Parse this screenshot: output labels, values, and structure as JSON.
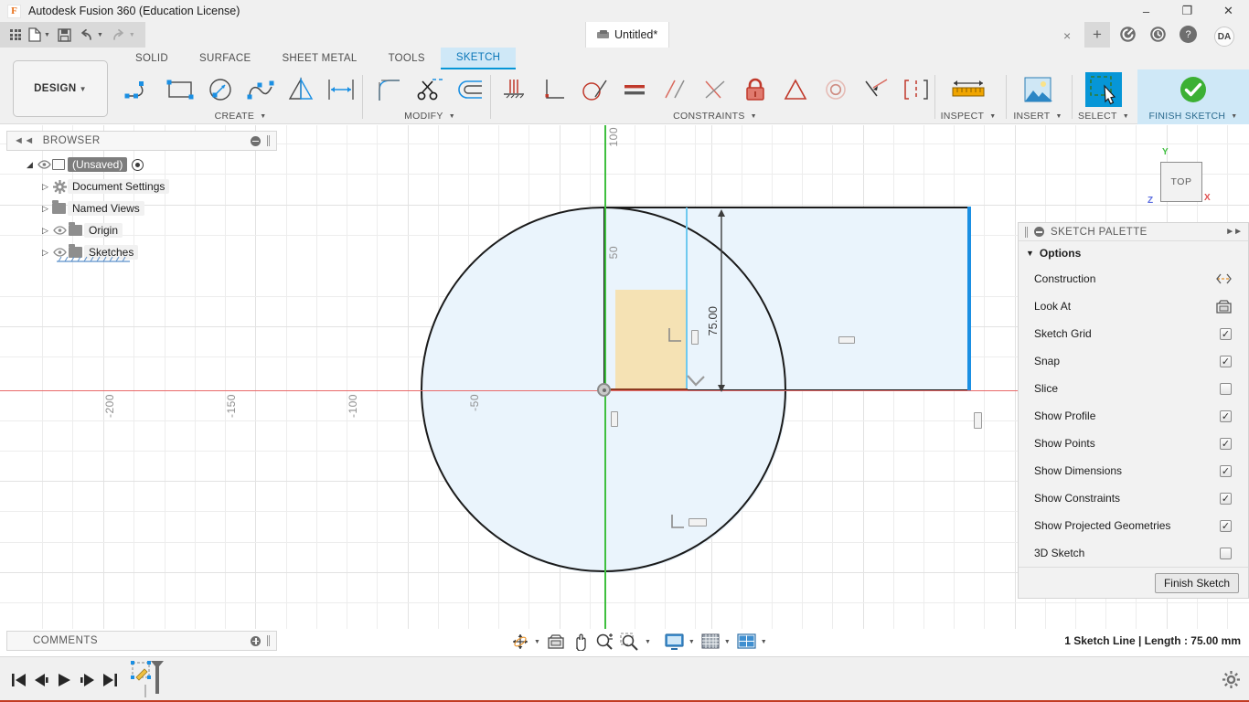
{
  "window": {
    "title": "Autodesk Fusion 360 (Education License)",
    "logo_icon": "fusion-logo-icon",
    "minimize_icon": "minimize-icon",
    "maximize_icon": "maximize-icon",
    "close_icon": "close-icon"
  },
  "quick_access": {
    "app_grid_icon": "app-grid-icon",
    "new_icon": "new-document-icon",
    "save_icon": "save-icon",
    "undo_icon": "undo-icon",
    "redo_icon": "redo-icon"
  },
  "document_tab": {
    "name": "Untitled*",
    "doc_icon": "document-icon",
    "close_label": "×",
    "new_tab_label": "+"
  },
  "top_right": {
    "job_status_icon": "job-status-icon",
    "recent_icon": "recent-clock-icon",
    "help_icon": "help-icon",
    "avatar_initials": "DA"
  },
  "workspace": {
    "label": "DESIGN"
  },
  "ribbon_tabs": [
    {
      "label": "SOLID",
      "active": false
    },
    {
      "label": "SURFACE",
      "active": false
    },
    {
      "label": "SHEET METAL",
      "active": false
    },
    {
      "label": "TOOLS",
      "active": false
    },
    {
      "label": "SKETCH",
      "active": true
    }
  ],
  "ribbon_groups": [
    {
      "name": "CREATE",
      "label": "CREATE",
      "has_dropdown": true,
      "tools": [
        {
          "name": "line-tool",
          "icon": "line-icon"
        },
        {
          "name": "rectangle-tool",
          "icon": "rectangle-icon"
        },
        {
          "name": "circle-tool",
          "icon": "circle-icon"
        },
        {
          "name": "spline-tool",
          "icon": "spline-icon"
        },
        {
          "name": "mirror-tool",
          "icon": "mirror-icon"
        },
        {
          "name": "sketch-dimension-tool",
          "icon": "dimension-icon"
        }
      ]
    },
    {
      "name": "MODIFY",
      "label": "MODIFY",
      "has_dropdown": true,
      "tools": [
        {
          "name": "fillet-tool",
          "icon": "fillet-icon"
        },
        {
          "name": "trim-tool",
          "icon": "scissors-icon"
        },
        {
          "name": "offset-tool",
          "icon": "offset-icon"
        }
      ]
    },
    {
      "name": "CONSTRAINTS",
      "label": "CONSTRAINTS",
      "has_dropdown": true,
      "tools": [
        {
          "name": "horizontal-vertical-constraint",
          "icon": "horizontal-vertical-icon"
        },
        {
          "name": "perpendicular-constraint",
          "icon": "perpendicular-icon"
        },
        {
          "name": "tangent-constraint",
          "icon": "tangent-icon"
        },
        {
          "name": "equal-constraint",
          "icon": "equal-icon"
        },
        {
          "name": "parallel-constraint",
          "icon": "parallel-icon"
        },
        {
          "name": "coincident-constraint",
          "icon": "coincident-icon"
        },
        {
          "name": "fix-unfix-constraint",
          "icon": "lock-icon"
        },
        {
          "name": "symmetry-constraint",
          "icon": "symmetry-triangle-icon"
        },
        {
          "name": "concentric-constraint",
          "icon": "concentric-icon"
        },
        {
          "name": "midpoint-constraint",
          "icon": "midpoint-icon"
        },
        {
          "name": "curvature-constraint",
          "icon": "curvature-icon"
        }
      ]
    },
    {
      "name": "INSPECT",
      "label": "INSPECT",
      "has_dropdown": true,
      "tools": [
        {
          "name": "measure-tool",
          "icon": "ruler-icon"
        }
      ]
    },
    {
      "name": "INSERT",
      "label": "INSERT",
      "has_dropdown": true,
      "tools": [
        {
          "name": "insert-image-tool",
          "icon": "image-icon"
        }
      ]
    },
    {
      "name": "SELECT",
      "label": "SELECT",
      "has_dropdown": true,
      "active": true,
      "tools": [
        {
          "name": "select-tool",
          "icon": "select-cursor-icon"
        }
      ]
    },
    {
      "name": "FINISH SKETCH",
      "label": "FINISH SKETCH",
      "has_dropdown": true,
      "highlighted": true,
      "tools": [
        {
          "name": "finish-sketch-tool",
          "icon": "green-check-icon"
        }
      ]
    }
  ],
  "browser": {
    "title": "BROWSER",
    "collapse_icon": "collapse-left-icon",
    "minus_icon": "minus-circle-icon",
    "grip_icon": "grip-icon",
    "items": [
      {
        "label": "(Unsaved)",
        "icon": "body-icon",
        "has_eye": true,
        "has_radio": true,
        "root": true,
        "arrow": "◢"
      },
      {
        "label": "Document Settings",
        "icon": "gear-icon",
        "has_eye": false,
        "arrow": "▷"
      },
      {
        "label": "Named Views",
        "icon": "folder-icon",
        "has_eye": false,
        "arrow": "▷"
      },
      {
        "label": "Origin",
        "icon": "folder-icon",
        "has_eye": true,
        "arrow": "▷"
      },
      {
        "label": "Sketches",
        "icon": "folder-sketch-icon",
        "has_eye": true,
        "arrow": "▷"
      }
    ]
  },
  "sketch_palette": {
    "title": "SKETCH PALETTE",
    "minus_icon": "minus-circle-icon",
    "expand_icon": "expand-right-icon",
    "section_label": "Options",
    "section_arrow": "▼",
    "options": [
      {
        "label": "Construction",
        "type": "icon",
        "icon": "construction-icon"
      },
      {
        "label": "Look At",
        "type": "icon",
        "icon": "look-at-icon"
      },
      {
        "label": "Sketch Grid",
        "type": "checkbox",
        "checked": true
      },
      {
        "label": "Snap",
        "type": "checkbox",
        "checked": true
      },
      {
        "label": "Slice",
        "type": "checkbox",
        "checked": false
      },
      {
        "label": "Show Profile",
        "type": "checkbox",
        "checked": true
      },
      {
        "label": "Show Points",
        "type": "checkbox",
        "checked": true
      },
      {
        "label": "Show Dimensions",
        "type": "checkbox",
        "checked": true
      },
      {
        "label": "Show Constraints",
        "type": "checkbox",
        "checked": true
      },
      {
        "label": "Show Projected Geometries",
        "type": "checkbox",
        "checked": true
      },
      {
        "label": "3D Sketch",
        "type": "checkbox",
        "checked": false
      }
    ],
    "finish_button": "Finish Sketch"
  },
  "canvas": {
    "dimension_label": "75.00",
    "grid_labels_x": [
      "-200",
      "-150",
      "-100",
      "-50"
    ],
    "grid_labels_y": [
      "100",
      "50"
    ],
    "viewcube": {
      "face": "TOP",
      "axis_x": "X",
      "axis_y": "Y",
      "axis_z": "Z"
    },
    "colors": {
      "profile_fill": "#eaf4fc",
      "selected_line": "#1a8fe3",
      "sketch_line": "#1a1a1a",
      "tan_region": "#f5dfae",
      "x_axis": "#e86a6a",
      "y_axis": "#3fbf3f",
      "projected_line": "#6fc9ef",
      "fixed_line": "#8c3a20"
    }
  },
  "comments": {
    "title": "COMMENTS",
    "add_icon": "plus-circle-icon",
    "grip_icon": "grip-icon"
  },
  "navigation_bar": [
    {
      "name": "orbit-tool",
      "icon": "orbit-icon",
      "dropdown": true
    },
    {
      "name": "look-at-tool",
      "icon": "look-at-icon",
      "dropdown": false
    },
    {
      "name": "pan-tool",
      "icon": "pan-hand-icon",
      "dropdown": false
    },
    {
      "name": "zoom-tool",
      "icon": "zoom-icon",
      "dropdown": false
    },
    {
      "name": "fit-tool",
      "icon": "zoom-fit-icon",
      "dropdown": true
    },
    {
      "name": "display-settings",
      "icon": "monitor-icon",
      "dropdown": true
    },
    {
      "name": "grid-and-snaps",
      "icon": "grid-icon",
      "dropdown": true
    },
    {
      "name": "viewports",
      "icon": "viewports-icon",
      "dropdown": true
    }
  ],
  "status_bar": {
    "text": "1 Sketch Line | Length : 75.00 mm"
  },
  "timeline": {
    "buttons": [
      {
        "name": "timeline-go-start",
        "icon": "skip-start-icon"
      },
      {
        "name": "timeline-step-back",
        "icon": "step-back-icon"
      },
      {
        "name": "timeline-play",
        "icon": "play-icon"
      },
      {
        "name": "timeline-step-forward",
        "icon": "step-forward-icon"
      },
      {
        "name": "timeline-go-end",
        "icon": "skip-end-icon"
      }
    ],
    "feature_icon": "sketch-feature-icon",
    "settings_icon": "settings-gear-icon"
  }
}
